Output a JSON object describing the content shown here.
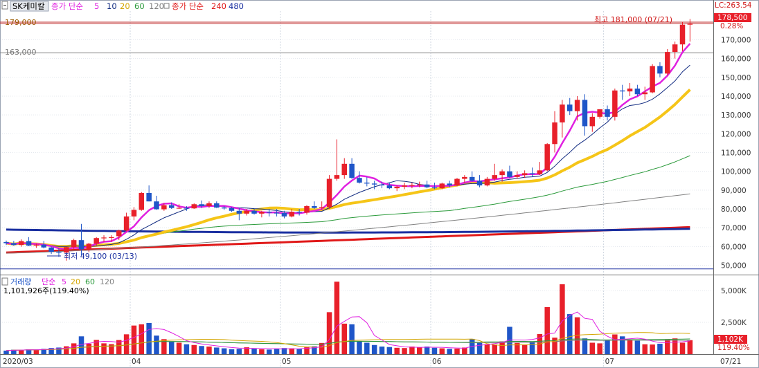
{
  "header": {
    "symbol": "SK케미칼",
    "ma_prefix": "종가 단순",
    "ma_periods": [
      "5",
      "10",
      "20",
      "60",
      "120"
    ],
    "ma2_prefix": "종가 단순",
    "ma2_periods": [
      "240",
      "480"
    ]
  },
  "volume_header": {
    "title": "거래량",
    "ma_prefix": "단순",
    "ma_periods": [
      "5",
      "20",
      "60",
      "120"
    ],
    "current": "1,101,926주(119.40%)"
  },
  "right_panel": {
    "lc_label": "LC:263.54",
    "last_price": "178,500",
    "change_pct": "0.28%",
    "last_volume": "1,102K",
    "volume_pct": "119.40%",
    "last_date": "07/21"
  },
  "annotations": {
    "high": "최고 181,000 (07/21)",
    "low": "최저 49,100 (03/13)",
    "line_179": "179,000",
    "line_163": "163,000"
  },
  "colors": {
    "up": "#e8202a",
    "down": "#1f56c8",
    "ma5": "#e020e0",
    "ma10": "#102a80",
    "ma20": "#f5c518",
    "ma60": "#2a9a3a",
    "ma120": "#808080",
    "ma240": "#1a2fa0",
    "ma480": "#e01818"
  },
  "chart_data": [
    {
      "type": "candlestick",
      "title": "SK케미칼",
      "x_tick_labels": [
        "2020/03",
        "04",
        "05",
        "06",
        "07"
      ],
      "y_tick_labels": [
        "50,000",
        "60,000",
        "70,000",
        "80,000",
        "90,000",
        "100,000",
        "110,000",
        "120,000",
        "130,000",
        "140,000",
        "150,000",
        "160,000",
        "170,000"
      ],
      "ylim": [
        45800,
        184500
      ],
      "grid": true,
      "reference_lines": [
        179000,
        163000,
        49100
      ],
      "series_labels": [
        "5",
        "10",
        "20",
        "60",
        "120",
        "240",
        "480"
      ],
      "month_boundaries": [
        {
          "label": "2020/03",
          "index": -1
        },
        {
          "label": "04",
          "index": 16.5
        },
        {
          "label": "05",
          "index": 36.5
        },
        {
          "label": "06",
          "index": 56.5
        },
        {
          "label": "07",
          "index": 79.5
        }
      ],
      "ohlc": [
        [
          62400,
          63200,
          60800,
          61800
        ],
        [
          61800,
          63000,
          60400,
          60800
        ],
        [
          60800,
          63800,
          59900,
          62900
        ],
        [
          62900,
          65000,
          60200,
          60500
        ],
        [
          60500,
          61500,
          59300,
          61000
        ],
        [
          61000,
          63000,
          59000,
          59500
        ],
        [
          59500,
          60000,
          56000,
          57200
        ],
        [
          57200,
          59000,
          54500,
          56800
        ],
        [
          56800,
          60000,
          52500,
          59700
        ],
        [
          59700,
          64200,
          58500,
          63400
        ],
        [
          63400,
          72000,
          55300,
          58500
        ],
        [
          58500,
          62000,
          57000,
          61500
        ],
        [
          61500,
          65000,
          60500,
          64500
        ],
        [
          64500,
          66000,
          62500,
          64800
        ],
        [
          64800,
          66000,
          62500,
          65000
        ],
        [
          65500,
          69000,
          63500,
          68500
        ],
        [
          68500,
          78000,
          68000,
          76000
        ],
        [
          76000,
          81000,
          74000,
          79500
        ],
        [
          79500,
          89000,
          79000,
          88500
        ],
        [
          88500,
          92500,
          84000,
          84000
        ],
        [
          84000,
          87000,
          79500,
          79800
        ],
        [
          79800,
          83000,
          79000,
          82000
        ],
        [
          82000,
          83500,
          80000,
          80500
        ],
        [
          80500,
          82500,
          80000,
          80600
        ],
        [
          80600,
          81500,
          79000,
          80300
        ],
        [
          80300,
          83000,
          80000,
          82500
        ],
        [
          82500,
          84500,
          80500,
          81500
        ],
        [
          81500,
          84000,
          80500,
          83000
        ],
        [
          83000,
          84000,
          80500,
          80700
        ],
        [
          80700,
          81500,
          79500,
          80500
        ],
        [
          80500,
          81000,
          78500,
          79000
        ],
        [
          79000,
          80500,
          74000,
          77500
        ],
        [
          77500,
          80000,
          76500,
          79000
        ],
        [
          79000,
          80000,
          77000,
          77500
        ],
        [
          77500,
          79000,
          75500,
          78500
        ],
        [
          78500,
          80000,
          76000,
          78000
        ],
        [
          78000,
          80000,
          76000,
          77800
        ],
        [
          77800,
          79000,
          75000,
          76000
        ],
        [
          76000,
          80000,
          75500,
          78500
        ],
        [
          78500,
          80000,
          76500,
          78000
        ],
        [
          78000,
          82000,
          77000,
          81500
        ],
        [
          81500,
          84000,
          80000,
          80500
        ],
        [
          80500,
          84000,
          79500,
          81000
        ],
        [
          81000,
          98000,
          80000,
          96000
        ],
        [
          96000,
          117000,
          95000,
          98000
        ],
        [
          98000,
          107000,
          96000,
          104000
        ],
        [
          104000,
          107000,
          96000,
          96500
        ],
        [
          96500,
          100000,
          93500,
          94000
        ],
        [
          94000,
          97000,
          92000,
          93500
        ],
        [
          93500,
          95000,
          90500,
          93000
        ],
        [
          93000,
          94500,
          91000,
          92500
        ],
        [
          92500,
          94000,
          90500,
          91000
        ],
        [
          91000,
          92500,
          89500,
          91800
        ],
        [
          91800,
          94000,
          90500,
          92500
        ],
        [
          92500,
          94000,
          91000,
          92700
        ],
        [
          92700,
          94500,
          91500,
          93000
        ],
        [
          93000,
          95000,
          91000,
          91500
        ],
        [
          91500,
          94000,
          90500,
          91000
        ],
        [
          91000,
          94000,
          90500,
          93500
        ],
        [
          93500,
          95000,
          91500,
          92500
        ],
        [
          92500,
          96500,
          92000,
          96000
        ],
        [
          96000,
          98000,
          94000,
          97000
        ],
        [
          97000,
          100000,
          94500,
          95000
        ],
        [
          95000,
          98000,
          91500,
          92500
        ],
        [
          92500,
          97000,
          92000,
          96000
        ],
        [
          96000,
          104000,
          95000,
          98000
        ],
        [
          98000,
          101000,
          94500,
          100000
        ],
        [
          100000,
          103000,
          96500,
          97000
        ],
        [
          97000,
          100000,
          96000,
          98000
        ],
        [
          98000,
          100500,
          96500,
          99000
        ],
        [
          99000,
          102000,
          97000,
          98500
        ],
        [
          98500,
          105000,
          98000,
          100500
        ],
        [
          100500,
          115000,
          100000,
          114500
        ],
        [
          114500,
          132000,
          110000,
          126000
        ],
        [
          126000,
          138000,
          118000,
          135500
        ],
        [
          135500,
          139000,
          130000,
          132000
        ],
        [
          132000,
          140000,
          127000,
          138000
        ],
        [
          138000,
          141000,
          119000,
          124000
        ],
        [
          124000,
          131000,
          121000,
          129000
        ],
        [
          129000,
          133000,
          128000,
          133000
        ],
        [
          133000,
          135000,
          127000,
          129000
        ],
        [
          129000,
          144000,
          127000,
          143000
        ],
        [
          143000,
          146000,
          138000,
          142500
        ],
        [
          142500,
          147000,
          140000,
          144000
        ],
        [
          144000,
          146000,
          140000,
          141000
        ],
        [
          141000,
          145000,
          138000,
          142000
        ],
        [
          142000,
          157000,
          141500,
          156000
        ],
        [
          156000,
          158000,
          150000,
          152000
        ],
        [
          152000,
          165000,
          151000,
          163500
        ],
        [
          163500,
          169000,
          160000,
          167500
        ],
        [
          167500,
          179500,
          164000,
          178000
        ],
        [
          178000,
          181000,
          169000,
          178500
        ]
      ]
    },
    {
      "type": "bar",
      "title": "거래량",
      "y_tick_labels": [
        "2,500K",
        "5,000K"
      ],
      "ylim": [
        0,
        6200000
      ],
      "values": [
        280000,
        350000,
        330000,
        380000,
        360000,
        420000,
        480000,
        520000,
        620000,
        850000,
        1400000,
        820000,
        1120000,
        850000,
        790000,
        1110000,
        1560000,
        2250000,
        2350000,
        2450000,
        1460000,
        1180000,
        980000,
        900000,
        780000,
        720000,
        640000,
        600000,
        520000,
        460000,
        390000,
        420000,
        540000,
        460000,
        380000,
        360000,
        420000,
        480000,
        460000,
        400000,
        540000,
        620000,
        880000,
        3300000,
        5700000,
        2400000,
        2350000,
        1000000,
        900000,
        720000,
        600000,
        560000,
        500000,
        480000,
        600000,
        540000,
        600000,
        500000,
        460000,
        420000,
        440000,
        520000,
        1200000,
        880000,
        780000,
        760000,
        1000000,
        2150000,
        880000,
        760000,
        980000,
        1580000,
        3700000,
        1300000,
        5500000,
        3150000,
        2900000,
        1240000,
        900000,
        850000,
        1140000,
        1550000,
        1400000,
        1120000,
        1060000,
        780000,
        760000,
        820000,
        1160000,
        1240000,
        900000,
        1102000
      ]
    }
  ]
}
